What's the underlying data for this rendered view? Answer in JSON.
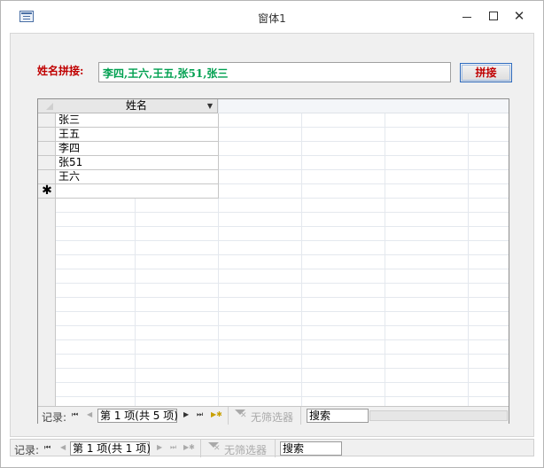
{
  "window": {
    "title": "窗体1",
    "minimize_label": "–",
    "close_label": "✕"
  },
  "form": {
    "concat_label": "姓名拼接:",
    "concat_result": "李四,王六,王五,张51,张三",
    "concat_button_label": "拼接"
  },
  "subform": {
    "column_header": "姓名",
    "names": [
      "张三",
      "王五",
      "李四",
      "张51",
      "王六"
    ],
    "new_record_marker": "✱",
    "nav": {
      "label": "记录:",
      "record_status": "第 1 项(共 5 项)",
      "filter_label": "无筛选器",
      "search_value": "搜索"
    }
  },
  "main_nav": {
    "label": "记录:",
    "record_status": "第 1 项(共 1 项)",
    "filter_label": "无筛选器",
    "search_value": "搜索"
  },
  "icons": {
    "first": "⏮",
    "prev": "◀",
    "next": "▶",
    "last": "⏭",
    "new": "▶✱"
  }
}
